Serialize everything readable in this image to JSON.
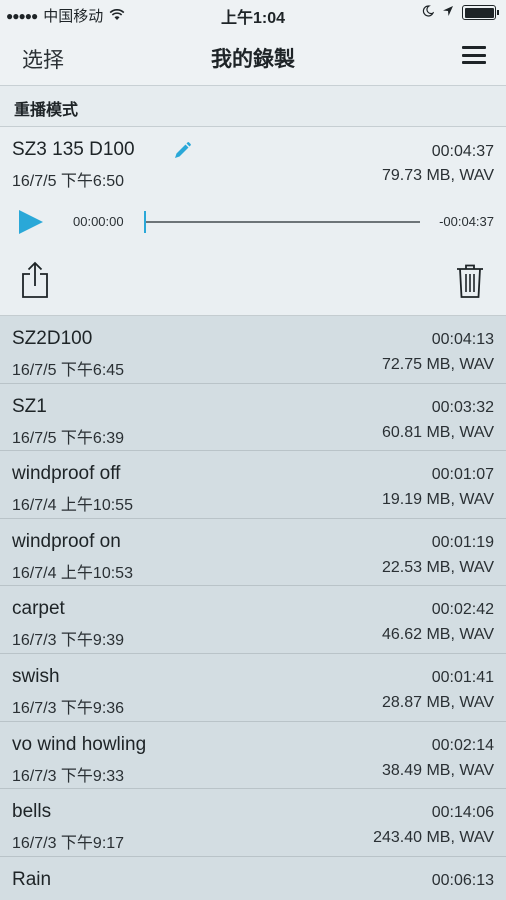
{
  "status_bar": {
    "signal_dots": "●●●●●",
    "carrier": "中国移动",
    "time": "上午1:04"
  },
  "nav": {
    "left_label": "选择",
    "title": "我的錄製"
  },
  "section_header": "重播模式",
  "selected": {
    "name": "SZ3 135 D100",
    "date": "16/7/5 下午6:50",
    "duration": "00:04:37",
    "size": "79.73 MB, WAV",
    "player": {
      "elapsed": "00:00:00",
      "remaining": "-00:04:37",
      "progress": 0
    }
  },
  "recordings": [
    {
      "name": "SZ2D100",
      "date": "16/7/5 下午6:45",
      "duration": "00:04:13",
      "size": "72.75 MB, WAV"
    },
    {
      "name": "SZ1",
      "date": "16/7/5 下午6:39",
      "duration": "00:03:32",
      "size": "60.81 MB, WAV"
    },
    {
      "name": "windproof off",
      "date": "16/7/4 上午10:55",
      "duration": "00:01:07",
      "size": "19.19 MB, WAV"
    },
    {
      "name": "windproof on",
      "date": "16/7/4 上午10:53",
      "duration": "00:01:19",
      "size": "22.53 MB, WAV"
    },
    {
      "name": "carpet",
      "date": "16/7/3 下午9:39",
      "duration": "00:02:42",
      "size": "46.62 MB, WAV"
    },
    {
      "name": "swish",
      "date": "16/7/3 下午9:36",
      "duration": "00:01:41",
      "size": "28.87 MB, WAV"
    },
    {
      "name": "vo wind howling",
      "date": "16/7/3 下午9:33",
      "duration": "00:02:14",
      "size": "38.49 MB, WAV"
    },
    {
      "name": "bells",
      "date": "16/7/3 下午9:17",
      "duration": "00:14:06",
      "size": "243.40 MB, WAV"
    },
    {
      "name": "Rain",
      "date": "",
      "duration": "00:06:13",
      "size": ""
    }
  ],
  "colors": {
    "accent": "#2aa8d8",
    "list_background": "#d3dde2",
    "bar_background": "#eef2f4"
  }
}
